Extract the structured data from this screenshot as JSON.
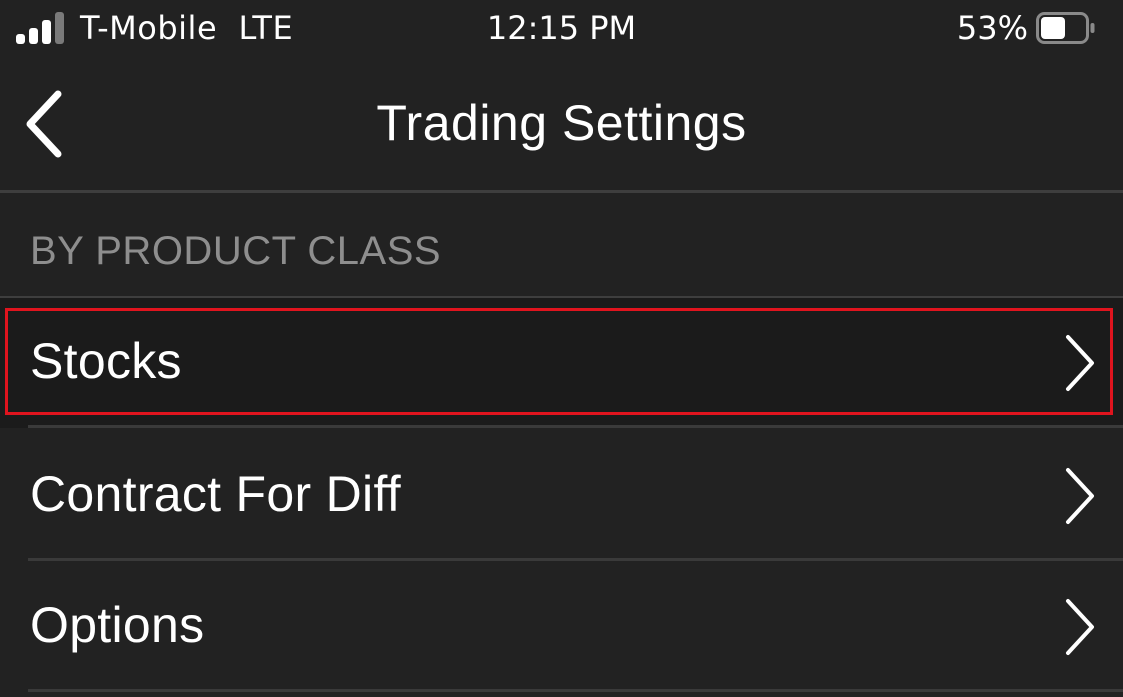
{
  "status_bar": {
    "carrier": "T-Mobile  LTE",
    "time": "12:15 PM",
    "battery_percent": "53%",
    "signal_bars_filled": 3,
    "signal_bars_total": 4,
    "battery_level": 0.53
  },
  "nav": {
    "title": "Trading Settings",
    "back_icon": "chevron-left-icon"
  },
  "section": {
    "header": "BY PRODUCT CLASS"
  },
  "rows": [
    {
      "label": "Stocks",
      "icon": "chevron-right-icon",
      "highlighted": true
    },
    {
      "label": "Contract For Diff",
      "icon": "chevron-right-icon",
      "highlighted": false
    },
    {
      "label": "Options",
      "icon": "chevron-right-icon",
      "highlighted": false
    }
  ],
  "colors": {
    "background": "#222222",
    "highlight_border": "#e0141e",
    "secondary_text": "#8e8e8e",
    "divider": "#3e3e3e"
  }
}
